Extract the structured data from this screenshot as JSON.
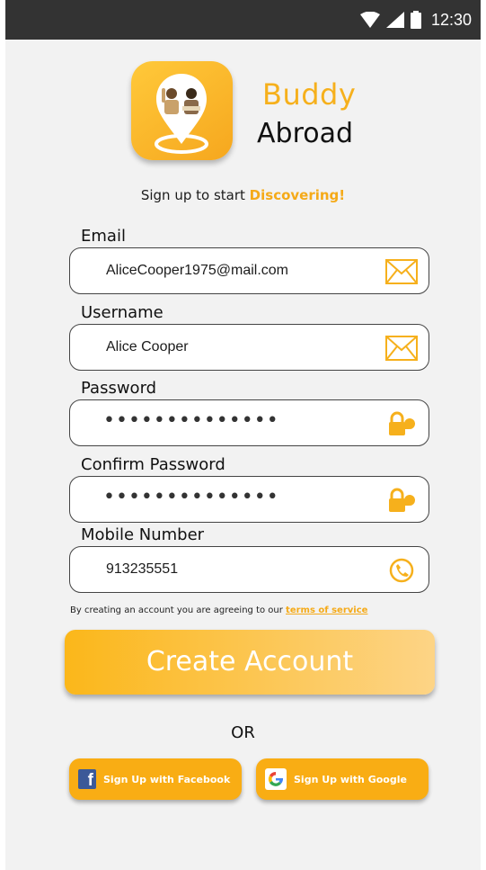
{
  "status_bar": {
    "time": "12:30",
    "icons": [
      "wifi-icon",
      "cell-signal-icon",
      "battery-icon"
    ]
  },
  "brand": {
    "name_line1": "Buddy",
    "name_line2": "Abroad",
    "logo_icon": "location-pin-travelers-icon"
  },
  "tagline": {
    "prefix": "Sign up to start ",
    "accent": "Discovering!"
  },
  "form": {
    "email": {
      "label": "Email",
      "value": "AliceCooper1975@mail.com",
      "icon": "envelope-icon"
    },
    "username": {
      "label": "Username",
      "value": "Alice Cooper",
      "icon": "envelope-icon"
    },
    "password": {
      "label": "Password",
      "value": "••••••••••••••",
      "icon": "lock-key-icon"
    },
    "confirm_password": {
      "label": "Confirm Password",
      "value": "••••••••••••••",
      "icon": "lock-key-icon"
    },
    "mobile": {
      "label": "Mobile Number",
      "value": "913235551",
      "icon": "phone-icon"
    }
  },
  "terms": {
    "text": "By creating an account you are agreeing to our ",
    "link": "terms of service"
  },
  "actions": {
    "create_account": "Create Account",
    "or": "OR",
    "facebook": "Sign Up with Facebook",
    "google": "Sign Up with Google"
  },
  "colors": {
    "accent": "#f6b01c",
    "button": "#f9ad14",
    "status_bar": "#333333"
  }
}
